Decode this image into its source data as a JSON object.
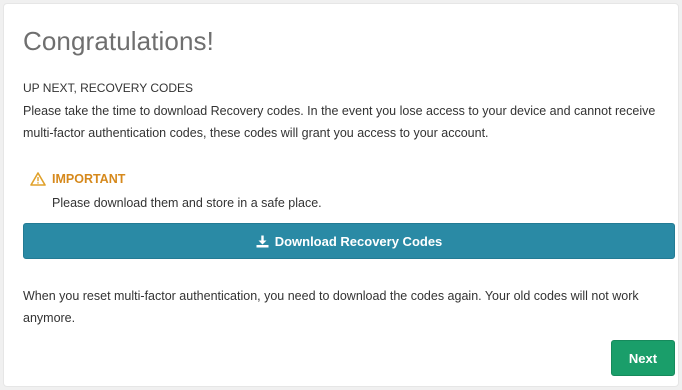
{
  "card": {
    "title": "Congratulations!",
    "subhead": "UP NEXT, RECOVERY CODES",
    "paragraph": "Please take the time to download Recovery codes. In the event you lose access to your device and cannot receive multi-factor authentication codes, these codes will grant you access to your account.",
    "important": {
      "icon": "warning-icon",
      "label": "IMPORTANT",
      "text": "Please download them and store in a safe place."
    },
    "download_button": {
      "icon": "download-icon",
      "label": "Download Recovery Codes"
    },
    "note": "When you reset multi-factor authentication, you need to download the codes again. Your old codes will not work anymore.",
    "next_button": "Next"
  },
  "colors": {
    "title": "#6f6f6f",
    "important": "#d6891c",
    "download_button_bg": "#2a8aa5",
    "next_button_bg": "#1a9e6a"
  }
}
